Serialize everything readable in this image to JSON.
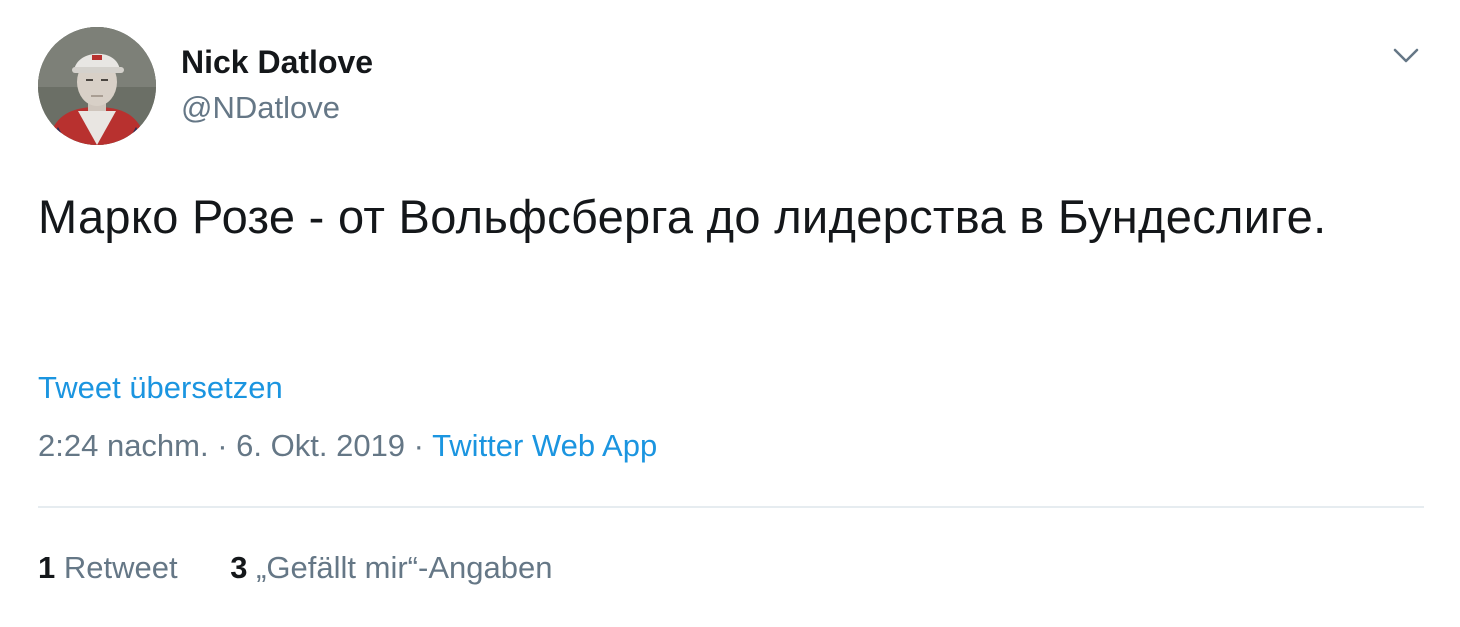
{
  "author": {
    "display_name": "Nick Datlove",
    "handle": "@NDatlove",
    "avatar_icon": "user-avatar-photo"
  },
  "menu": {
    "icon": "chevron-down-icon"
  },
  "tweet": {
    "text": "Марко Розе - от Вольфсберга до лидерства в Бундеслиге.",
    "translate_label": "Tweet übersetzen",
    "time": "2:24 nachm.",
    "separator1": " · ",
    "date": "6. Okt. 2019",
    "separator2": " · ",
    "source": "Twitter Web App"
  },
  "stats": {
    "retweets": {
      "count": "1",
      "label": "Retweet"
    },
    "likes": {
      "count": "3",
      "label": "„Gefällt mir“-Angaben"
    }
  },
  "colors": {
    "link": "#1b95e0",
    "secondary_text": "#657786",
    "primary_text": "#14171a",
    "divider": "#e6ecf0"
  }
}
